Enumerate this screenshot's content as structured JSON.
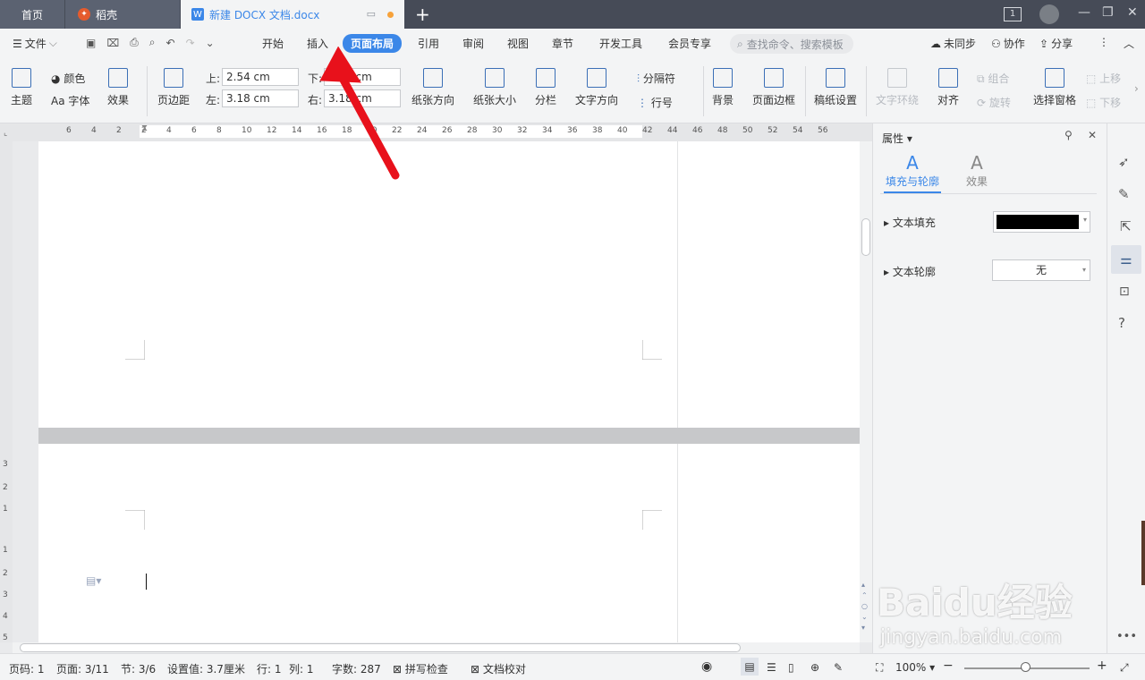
{
  "tabs": {
    "home": "首页",
    "daoke": "稻壳",
    "doc": "新建 DOCX 文档.docx",
    "doc_icon": "W"
  },
  "menu": {
    "file": "文件",
    "tabs": [
      "开始",
      "插入",
      "页面布局",
      "引用",
      "审阅",
      "视图",
      "章节",
      "开发工具",
      "会员专享"
    ],
    "active_tab": "页面布局",
    "search_placeholder": "查找命令、搜索模板",
    "unsync": "未同步",
    "collab": "协作",
    "share": "分享"
  },
  "ribbon": {
    "theme": "主题",
    "color": "颜色",
    "font": "Aa 字体",
    "effect": "效果",
    "margin": "页边距",
    "top_label": "上:",
    "top_value": "2.54 cm",
    "left_label": "左:",
    "left_value": "3.18 cm",
    "bottom_label": "下:",
    "bottom_value": "2.54 cm",
    "right_label": "右:",
    "right_value": "3.18 cm",
    "orientation": "纸张方向",
    "size": "纸张大小",
    "columns": "分栏",
    "text_direction": "文字方向",
    "separator": "分隔符",
    "line_number": "行号",
    "background": "背景",
    "page_border": "页面边框",
    "manuscript": "稿纸设置",
    "text_wrap": "文字环绕",
    "align": "对齐",
    "group": "组合",
    "rotate": "旋转",
    "select_pane": "选择窗格",
    "bring_forward": "上移",
    "send_backward": "下移"
  },
  "ruler_numbers": [
    "6",
    "4",
    "2",
    "2",
    "4",
    "6",
    "8",
    "10",
    "12",
    "14",
    "16",
    "18",
    "20",
    "22",
    "24",
    "26",
    "28",
    "30",
    "32",
    "34",
    "36",
    "38",
    "40",
    "42",
    "44",
    "46",
    "48",
    "50",
    "52",
    "54",
    "56"
  ],
  "vruler_numbers": [
    "3",
    "2",
    "1",
    "1",
    "2",
    "3",
    "4",
    "5"
  ],
  "props": {
    "title": "属性",
    "tab_fill": "填充与轮廓",
    "tab_effect": "效果",
    "text_fill": "文本填充",
    "text_outline": "文本轮廓",
    "outline_value": "无",
    "fill_color": "#000000"
  },
  "status": {
    "page_code": "页码: 1",
    "page": "页面: 3/11",
    "section": "节: 3/6",
    "setting": "设置值: 3.7厘米",
    "row": "行: 1",
    "col": "列: 1",
    "words": "字数: 287",
    "spell": "拼写检查",
    "proof": "文档校对",
    "zoom": "100%"
  },
  "watermark": {
    "brand": "Baidu经验",
    "url": "jingyan.baidu.com"
  },
  "colors": {
    "accent": "#3b87e8",
    "arrow": "#e8111b"
  }
}
